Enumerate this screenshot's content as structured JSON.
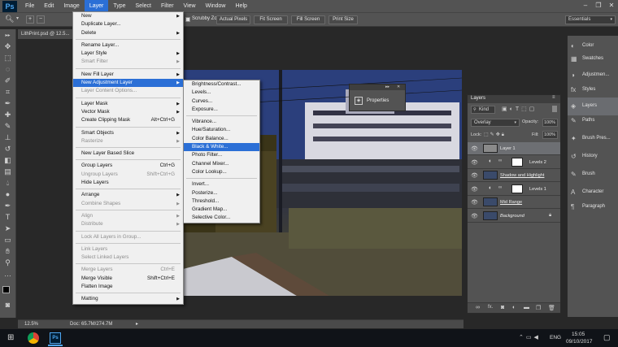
{
  "menubar": {
    "logo": "Ps",
    "items": [
      "File",
      "Edit",
      "Image",
      "Layer",
      "Type",
      "Select",
      "Filter",
      "View",
      "Window",
      "Help"
    ],
    "active_index": 3
  },
  "window_controls": [
    "–",
    "❐",
    "✕"
  ],
  "options_bar": {
    "scrubby_zoom": "Scrubby Zoom",
    "actual_pixels": "Actual Pixels",
    "fit_screen": "Fit Screen",
    "fill_screen": "Fill Screen",
    "print_size": "Print Size",
    "workspace": "Essentials"
  },
  "document": {
    "tab_title": "LithPrint.psd @ 12.5...",
    "zoom": "12.5%",
    "doc_info": "Doc: 65.7M/274.7M"
  },
  "layer_menu": [
    {
      "label": "New",
      "arrow": true
    },
    {
      "label": "Duplicate Layer..."
    },
    {
      "label": "Delete",
      "arrow": true
    },
    {
      "sep": true
    },
    {
      "label": "Rename Layer..."
    },
    {
      "label": "Layer Style",
      "arrow": true
    },
    {
      "label": "Smart Filter",
      "disabled": true,
      "arrow": true
    },
    {
      "sep": true
    },
    {
      "label": "New Fill Layer",
      "arrow": true
    },
    {
      "label": "New Adjustment Layer",
      "arrow": true,
      "highlight": true
    },
    {
      "label": "Layer Content Options...",
      "disabled": true
    },
    {
      "sep": true
    },
    {
      "label": "Layer Mask",
      "arrow": true
    },
    {
      "label": "Vector Mask",
      "arrow": true
    },
    {
      "label": "Create Clipping Mask",
      "shortcut": "Alt+Ctrl+G"
    },
    {
      "sep": true
    },
    {
      "label": "Smart Objects",
      "arrow": true
    },
    {
      "label": "Rasterize",
      "disabled": true,
      "arrow": true
    },
    {
      "sep": true
    },
    {
      "label": "New Layer Based Slice"
    },
    {
      "sep": true
    },
    {
      "label": "Group Layers",
      "shortcut": "Ctrl+G"
    },
    {
      "label": "Ungroup Layers",
      "shortcut": "Shift+Ctrl+G",
      "disabled": true
    },
    {
      "label": "Hide Layers"
    },
    {
      "sep": true
    },
    {
      "label": "Arrange",
      "arrow": true
    },
    {
      "label": "Combine Shapes",
      "disabled": true,
      "arrow": true
    },
    {
      "sep": true
    },
    {
      "label": "Align",
      "disabled": true,
      "arrow": true
    },
    {
      "label": "Distribute",
      "disabled": true,
      "arrow": true
    },
    {
      "sep": true
    },
    {
      "label": "Lock All Layers in Group...",
      "disabled": true
    },
    {
      "sep": true
    },
    {
      "label": "Link Layers",
      "disabled": true
    },
    {
      "label": "Select Linked Layers",
      "disabled": true
    },
    {
      "sep": true
    },
    {
      "label": "Merge Layers",
      "shortcut": "Ctrl+E",
      "disabled": true
    },
    {
      "label": "Merge Visible",
      "shortcut": "Shift+Ctrl+E"
    },
    {
      "label": "Flatten Image"
    },
    {
      "sep": true
    },
    {
      "label": "Matting",
      "arrow": true
    }
  ],
  "adjustment_submenu": [
    {
      "label": "Brightness/Contrast..."
    },
    {
      "label": "Levels..."
    },
    {
      "label": "Curves..."
    },
    {
      "label": "Exposure..."
    },
    {
      "sep": true
    },
    {
      "label": "Vibrance..."
    },
    {
      "label": "Hue/Saturation..."
    },
    {
      "label": "Color Balance..."
    },
    {
      "label": "Black & White...",
      "highlight": true
    },
    {
      "label": "Photo Filter..."
    },
    {
      "label": "Channel Mixer..."
    },
    {
      "label": "Color Lookup..."
    },
    {
      "sep": true
    },
    {
      "label": "Invert..."
    },
    {
      "label": "Posterize..."
    },
    {
      "label": "Threshold..."
    },
    {
      "label": "Gradient Map..."
    },
    {
      "label": "Selective Color..."
    }
  ],
  "properties_panel": {
    "title": "Properties",
    "collapse": "▸▸",
    "close": "✕"
  },
  "layers_panel": {
    "title": "Layers",
    "filter": "Kind",
    "blend_mode": "Overlay",
    "opacity_label": "Opacity:",
    "opacity": "100%",
    "lock_label": "Lock:",
    "fill_label": "Fill:",
    "fill": "100%",
    "layers": [
      {
        "name": "Layer 1",
        "type": "pixel",
        "thumb": "#8a8a8a",
        "selected": true
      },
      {
        "name": "Levels 2",
        "type": "adjustment",
        "thumb": "#ffffff"
      },
      {
        "name": "Shadow and Highlight",
        "type": "smart",
        "thumb": "#3a4a6a",
        "underline": true
      },
      {
        "name": "Levels 1",
        "type": "adjustment",
        "thumb": "#ffffff"
      },
      {
        "name": "Mid Range",
        "type": "smart",
        "thumb": "#3a4a6a",
        "underline": true
      },
      {
        "name": "Background",
        "type": "pixel",
        "thumb": "#3a4a6a",
        "italic": true,
        "locked": true
      }
    ],
    "footer_icons": [
      "link-icon",
      "fx-icon",
      "mask-icon",
      "adjustment-icon",
      "folder-icon",
      "new-layer-icon",
      "trash-icon"
    ]
  },
  "dock": [
    {
      "label": "Color",
      "icon": "◐"
    },
    {
      "label": "Swatches",
      "icon": "▦"
    },
    {
      "label": "Adjustmen...",
      "icon": "◑"
    },
    {
      "label": "Styles",
      "icon": "fx"
    },
    {
      "label": "Layers",
      "icon": "◈"
    },
    {
      "label": "Paths",
      "icon": "✎"
    },
    {
      "label": "Brush Pres...",
      "icon": "✦"
    },
    {
      "label": "History",
      "icon": "↺"
    },
    {
      "label": "Brush",
      "icon": "✎"
    },
    {
      "label": "Character",
      "icon": "A"
    },
    {
      "label": "Paragraph",
      "icon": "¶"
    }
  ],
  "taskbar": {
    "lang": "ENG",
    "time": "15:05",
    "date": "09/10/2017"
  },
  "colors": {
    "highlight": "#2b6fd6",
    "panel": "#535353",
    "workspace": "#282828"
  }
}
